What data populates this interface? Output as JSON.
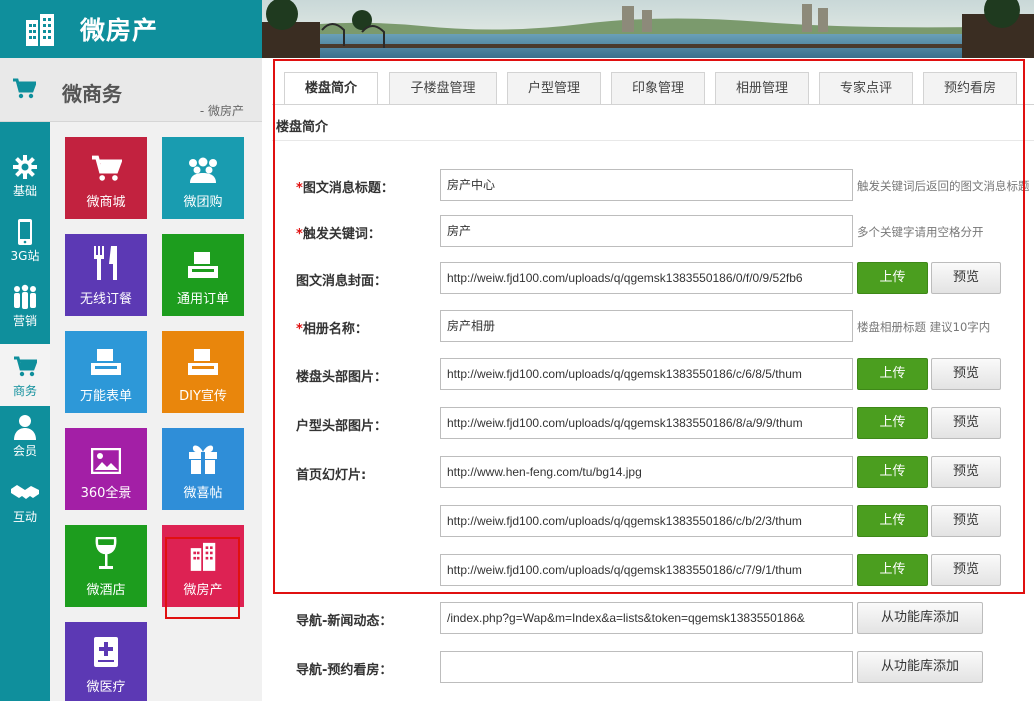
{
  "brand": {
    "title": "微房产"
  },
  "section": {
    "name": "微商务",
    "crumb": "- 微房产"
  },
  "rail": [
    {
      "label": "基础",
      "icon": "gear-icon"
    },
    {
      "label": "3G站",
      "icon": "mobile-icon"
    },
    {
      "label": "营销",
      "icon": "people-icon"
    },
    {
      "label": "商务",
      "icon": "cart-icon",
      "active": true
    },
    {
      "label": "会员",
      "icon": "user-icon"
    },
    {
      "label": "互动",
      "icon": "handshake-icon"
    }
  ],
  "tiles": [
    {
      "label": "微商城",
      "color": "#c2223f",
      "icon": "cart-icon"
    },
    {
      "label": "微团购",
      "color": "#199cb0",
      "icon": "group-icon"
    },
    {
      "label": "无线订餐",
      "color": "#5c39b4",
      "icon": "cutlery-icon"
    },
    {
      "label": "通用订单",
      "color": "#1d9d1e",
      "icon": "printer-icon"
    },
    {
      "label": "万能表单",
      "color": "#2d98d8",
      "icon": "printer-icon"
    },
    {
      "label": "DIY宣传",
      "color": "#e9860c",
      "icon": "printer-icon"
    },
    {
      "label": "360全景",
      "color": "#a31fa6",
      "icon": "image-icon"
    },
    {
      "label": "微喜帖",
      "color": "#2f8ed8",
      "icon": "gift-icon"
    },
    {
      "label": "微酒店",
      "color": "#1d9d1e",
      "icon": "wineglass-icon"
    },
    {
      "label": "微房产",
      "color": "#dd2253",
      "icon": "building-icon"
    },
    {
      "label": "微医疗",
      "color": "#5c39b4",
      "icon": "medical-book-icon"
    }
  ],
  "tabs": [
    "楼盘简介",
    "子楼盘管理",
    "户型管理",
    "印象管理",
    "相册管理",
    "专家点评",
    "预约看房"
  ],
  "form": {
    "section_title": "楼盘简介",
    "upload_label": "上传",
    "preview_label": "预览",
    "library_label": "从功能库添加",
    "rows": [
      {
        "label": "图文消息标题：",
        "required": true,
        "value": "房产中心",
        "hint": "触发关键词后返回的图文消息标题"
      },
      {
        "label": "触发关键词：",
        "required": true,
        "value": "房产",
        "hint": "多个关键字请用空格分开"
      },
      {
        "label": "图文消息封面：",
        "required": false,
        "value": "http://weiw.fjd100.com/uploads/q/qgemsk1383550186/0/f/0/9/52fb6"
      },
      {
        "label": "相册名称：",
        "required": true,
        "value": "房产相册",
        "hint": "楼盘相册标题 建议10字内"
      },
      {
        "label": "楼盘头部图片：",
        "required": false,
        "value": "http://weiw.fjd100.com/uploads/q/qgemsk1383550186/c/6/8/5/thum"
      },
      {
        "label": "户型头部图片：",
        "required": false,
        "value": "http://weiw.fjd100.com/uploads/q/qgemsk1383550186/8/a/9/9/thum"
      },
      {
        "label": "首页幻灯片:",
        "required": false,
        "value": "http://www.hen-feng.com/tu/bg14.jpg"
      },
      {
        "label": "",
        "required": false,
        "value": "http://weiw.fjd100.com/uploads/q/qgemsk1383550186/c/b/2/3/thum"
      },
      {
        "label": "",
        "required": false,
        "value": "http://weiw.fjd100.com/uploads/q/qgemsk1383550186/c/7/9/1/thum"
      },
      {
        "label": "导航-新闻动态：",
        "required": false,
        "value": "/index.php?g=Wap&m=Index&a=lists&token=qgemsk1383550186&"
      },
      {
        "label": "导航-预约看房：",
        "required": false,
        "value": ""
      }
    ]
  }
}
